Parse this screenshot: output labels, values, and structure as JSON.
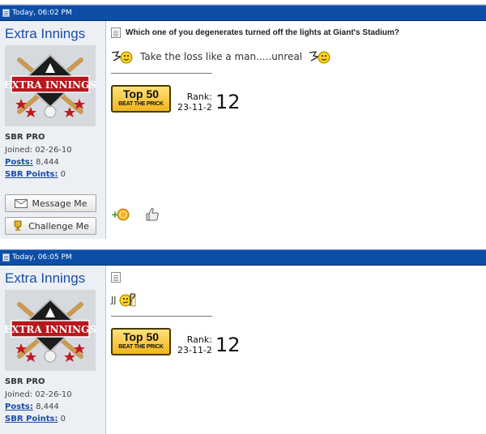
{
  "posts": [
    {
      "timestamp": "Today, 06:02 PM",
      "username": "Extra Innings",
      "user_title": "SBR PRO",
      "joined_label": "Joined:",
      "joined_value": "02-26-10",
      "posts_label": "Posts:",
      "posts_value": "8,444",
      "points_label": "SBR Points:",
      "points_value": "0",
      "message_btn": "Message Me",
      "challenge_btn": "Challenge Me",
      "title": "Which one of you degenerates turned off the lights at Giant's Stadium?",
      "message": "Take the loss like a man.....unreal",
      "badge_line1": "Top 50",
      "badge_line2": "BEAT THE PRICK",
      "rank_label": "Rank:",
      "rank_date": "23-11-2",
      "rank_number": "12",
      "avatar_text": "EXTRA INNINGS"
    },
    {
      "timestamp": "Today, 06:05 PM",
      "username": "Extra Innings",
      "user_title": "SBR PRO",
      "joined_label": "Joined:",
      "joined_value": "02-26-10",
      "posts_label": "Posts:",
      "posts_value": "8,444",
      "points_label": "SBR Points:",
      "points_value": "0",
      "title": "",
      "message": "JJ",
      "badge_line1": "Top 50",
      "badge_line2": "BEAT THE PRICK",
      "rank_label": "Rank:",
      "rank_date": "23-11-2",
      "rank_number": "12",
      "avatar_text": "EXTRA INNINGS"
    }
  ],
  "colors": {
    "header_blue": "#0b4ea8",
    "link_blue": "#1a4aa6",
    "userbox_bg": "#ecf0f4"
  },
  "icons": [
    "page-icon",
    "document-icon",
    "speech-smiley-icon",
    "envelope-icon",
    "trophy-icon",
    "add-points-icon",
    "thumbs-up-icon"
  ]
}
